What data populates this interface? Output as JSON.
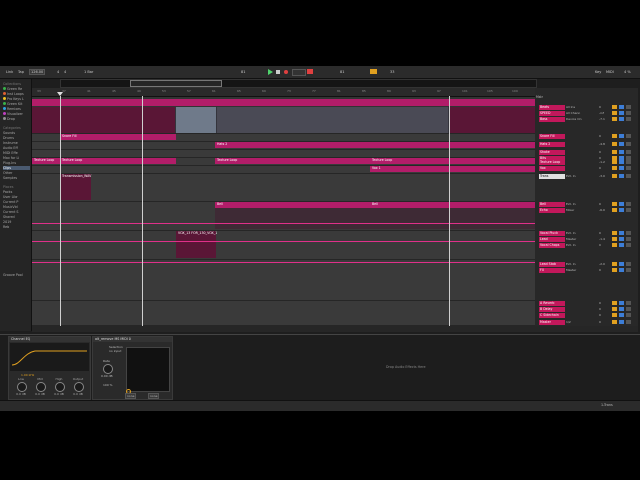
{
  "transport": {
    "link": "Link",
    "tap": "Tap",
    "tempo": "126.00",
    "sig_num": "4",
    "sig_den": "4",
    "metro_bar": "1 Bar",
    "position": "81",
    "loop_start": "81",
    "loop_len": "33",
    "key": "Key",
    "midi": "MIDI",
    "cpu": "4 %"
  },
  "browser": {
    "collections_header": "Collections",
    "collections": [
      {
        "label": "Green Re",
        "color": "#38b24a"
      },
      {
        "label": "Inst Loops",
        "color": "#e06030"
      },
      {
        "label": "Pro Keys L",
        "color": "#f0c020"
      },
      {
        "label": "Green Kit",
        "color": "#38b24a"
      },
      {
        "label": "Remixes",
        "color": "#30a0e0"
      },
      {
        "label": "Visualizer",
        "color": "#c040c0"
      },
      {
        "label": "Drop",
        "color": "#909090"
      }
    ],
    "categories_header": "Categories",
    "categories": [
      "Sounds",
      "Drums",
      "Instrume",
      "Audio Eff",
      "MIDI Effe",
      "Max for Li",
      "Plug-Ins",
      "Clips",
      "Other",
      "Samples"
    ],
    "places_header": "Places",
    "places": [
      "Packs",
      "User Libr",
      "Current P",
      "MusicVid",
      "Current S",
      "Shared",
      "2019",
      "Reb"
    ],
    "footer": "Groove Pool"
  },
  "ruler_ticks": [
    "1:34",
    "1:38",
    "1:42",
    "1:46",
    "1:50",
    "1:54",
    "1:58",
    "2:02",
    "2:06",
    "2:10",
    "2:14",
    "2:18",
    "2:22",
    "2:26",
    "2:30",
    "2:34",
    "2:38",
    "2:42",
    "2:46",
    "2:50",
    "2:54",
    "2:58"
  ],
  "ruler_bars": [
    "33",
    "37",
    "41",
    "45",
    "49",
    "53",
    "57",
    "61",
    "65",
    "69",
    "73",
    "77",
    "81",
    "85",
    "89",
    "93",
    "97",
    "101",
    "105",
    "109"
  ],
  "clips": {
    "snare_fill": "Snare Fill",
    "hats": "Hats 2",
    "texture_a": "Texture Loop",
    "texture_b": "Texture Loop",
    "texture_c": "Texture Loop",
    "texture_d": "Texture Loop",
    "vox1": "Vox 1",
    "transmission": "Transmission_WAV",
    "bell_a": "Bell",
    "bell_b": "Bell",
    "vox_sample": "VOX_13 FOR_130_VOX_1"
  },
  "mixer": {
    "header": "Mstr",
    "tracks": [
      {
        "name": "Beats",
        "in": "All Ins",
        "vol": "0"
      },
      {
        "name": "SPEED",
        "in": "All Chann",
        "vol": "-inf"
      },
      {
        "name": "Bass",
        "in": "Device On",
        "vol": "-7.1"
      },
      {
        "name": "Snare Fill",
        "in": "",
        "vol": "0"
      },
      {
        "name": "Hats 2",
        "in": "",
        "vol": "-4.8"
      },
      {
        "name": "Shake",
        "in": "",
        "vol": "0"
      },
      {
        "name": "Bits",
        "in": "",
        "vol": "0"
      },
      {
        "name": "Texture Loop",
        "in": "",
        "vol": "-1.2"
      },
      {
        "name": "Vox",
        "in": "",
        "vol": "0"
      },
      {
        "name": "Trans",
        "in": "Ext. In",
        "vol": "-3.0",
        "selected": true
      },
      {
        "name": "Bell",
        "in": "Ext. In",
        "vol": "0"
      },
      {
        "name": "Echo",
        "in": "Mixer",
        "vol": "-6.0"
      },
      {
        "name": "Vocal Pluck",
        "in": "Ext. In",
        "vol": "0"
      },
      {
        "name": "Lead",
        "in": "Master",
        "vol": "-1.4"
      },
      {
        "name": "Vocal Chops",
        "in": "Ext. In",
        "vol": "0"
      },
      {
        "name": "Lead Stab",
        "in": "Ext. In",
        "vol": "-2.0"
      },
      {
        "name": "FX",
        "in": "Master",
        "vol": "0"
      },
      {
        "name": "A Reverb",
        "in": "",
        "vol": "0"
      },
      {
        "name": "B Delay",
        "in": "",
        "vol": "0"
      },
      {
        "name": "C Sidechain",
        "in": "",
        "vol": "0"
      },
      {
        "name": "Master",
        "in": "1/2",
        "vol": "0"
      }
    ]
  },
  "devices": {
    "eq_title": "Channel EQ",
    "eq_freq": "1.00 kHz",
    "eq_knobs": [
      {
        "label": "Low",
        "value": "0.0 dB"
      },
      {
        "label": "Mid",
        "value": "0.0 dB"
      },
      {
        "label": "High",
        "value": "0.0 dB"
      },
      {
        "label": "Output",
        "value": "0.0 dB"
      }
    ],
    "m4l_title": "alt_remove MS MIDI 0",
    "m4l_sub": "Selection",
    "m4l_sub2": "no input",
    "m4l_rate_label": "Rate",
    "m4l_rate": "0.00 dB",
    "m4l_gain": "100 %",
    "m4l_mode_a": "none",
    "m4l_mode_b": "none",
    "drop_hint": "Drop Audio Effects Here"
  },
  "status": {
    "right_label": "Vol",
    "track_label": "1-Trans"
  }
}
